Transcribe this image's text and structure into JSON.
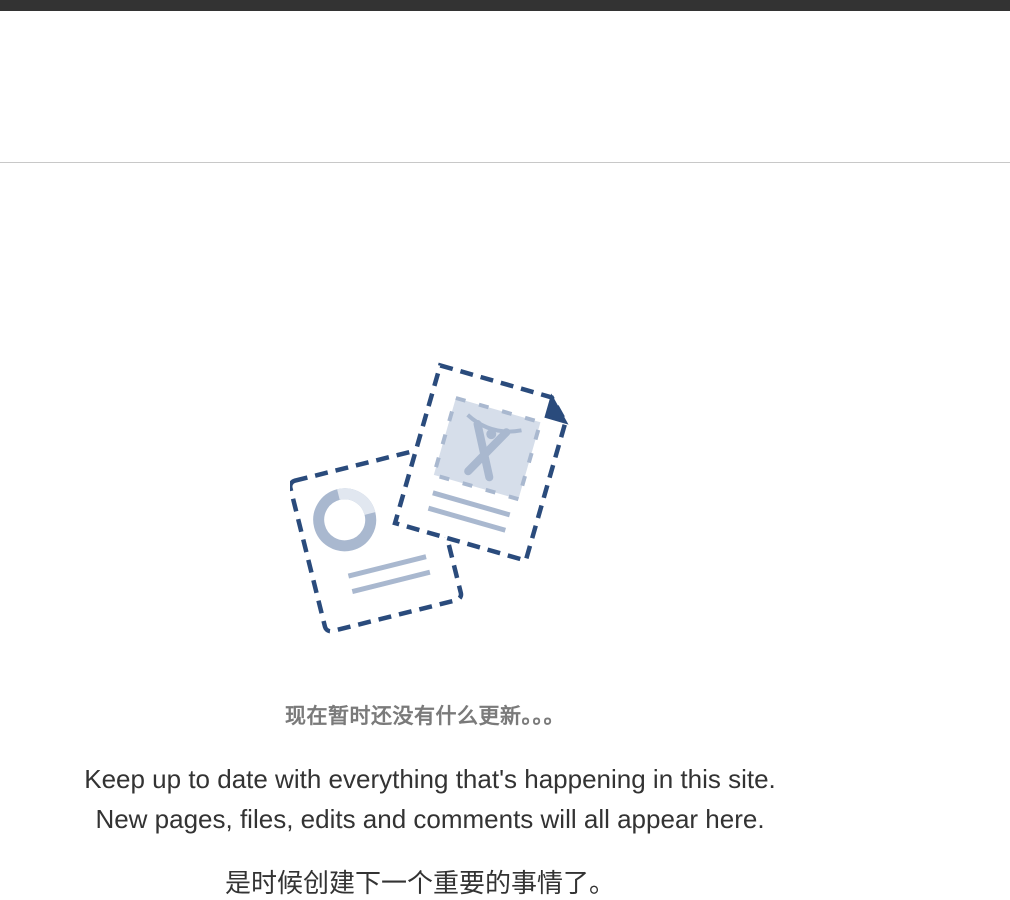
{
  "empty_state": {
    "illustration_icon": "documents-illustration-icon",
    "heading": "现在暂时还没有什么更新。。。",
    "description_line1": "Keep up to date with everything that's happening in this site.",
    "description_line2": "New pages, files, edits and comments will all appear here.",
    "call_to_action": "是时候创建下一个重要的事情了。"
  },
  "colors": {
    "top_bar": "#333333",
    "dash_stroke": "#2a4b7c",
    "light_accent": "#a9b8cf",
    "heading_text": "#7a7a7a",
    "body_text": "#333333"
  }
}
